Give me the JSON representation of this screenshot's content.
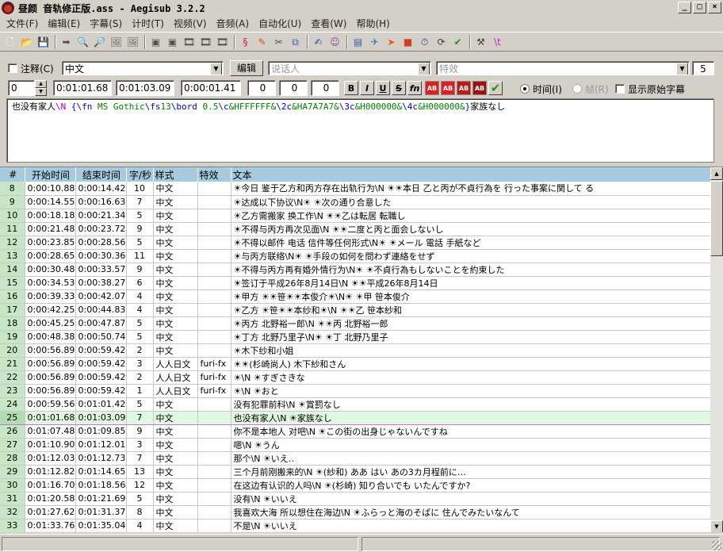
{
  "window": {
    "title": "昼颜 音轨修正版.ass - Aegisub 3.2.2",
    "controls": [
      "_",
      "□",
      "×"
    ]
  },
  "menu": [
    "文件(F)",
    "编辑(E)",
    "字幕(S)",
    "计时(T)",
    "视频(V)",
    "音频(A)",
    "自动化(U)",
    "查看(W)",
    "帮助(H)"
  ],
  "toolbar": [
    {
      "icon": "new-file-icon",
      "glyph": "🗋",
      "color": "#ffffff"
    },
    {
      "icon": "open-folder-icon",
      "glyph": "📂",
      "color": "#d8a838"
    },
    {
      "icon": "save-icon",
      "glyph": "💾",
      "color": "#303060"
    },
    {
      "sep": true
    },
    {
      "icon": "jump-to-icon",
      "glyph": "➡",
      "color": "#505050"
    },
    {
      "icon": "zoom-in-icon",
      "glyph": "🔍",
      "color": "#404040"
    },
    {
      "icon": "zoom-out-icon",
      "glyph": "🔎",
      "color": "#404040"
    },
    {
      "icon": "snapshot-icon",
      "glyph": "🖼",
      "color": "#606060"
    },
    {
      "icon": "snapshot-copy-icon",
      "glyph": "🖼",
      "color": "#606060"
    },
    {
      "sep": true
    },
    {
      "icon": "video-tool-icon",
      "glyph": "▣",
      "color": "#505050"
    },
    {
      "icon": "video-tool-icon",
      "glyph": "▣",
      "color": "#505050"
    },
    {
      "icon": "film-icon",
      "glyph": "🎞",
      "color": "#303030"
    },
    {
      "icon": "film-icon",
      "glyph": "🎞",
      "color": "#303030"
    },
    {
      "icon": "film-icon",
      "glyph": "🎞",
      "color": "#303030"
    },
    {
      "sep": true
    },
    {
      "icon": "styles-icon",
      "glyph": "§",
      "color": "#c02040"
    },
    {
      "icon": "pen-icon",
      "glyph": "✎",
      "color": "#d05020"
    },
    {
      "icon": "attachment-icon",
      "glyph": "✂",
      "color": "#505050"
    },
    {
      "icon": "copy-icon",
      "glyph": "⧉",
      "color": "#3060c0"
    },
    {
      "sep": true
    },
    {
      "icon": "translation-icon",
      "glyph": "✍",
      "color": "#2050b0"
    },
    {
      "icon": "karaoke-icon",
      "glyph": "☺",
      "color": "#9040a0"
    },
    {
      "sep": true
    },
    {
      "icon": "timing-icon",
      "glyph": "▤",
      "color": "#3060b0"
    },
    {
      "icon": "shift-times-icon",
      "glyph": "✈",
      "color": "#2080c0"
    },
    {
      "icon": "arrow-icon",
      "glyph": "➤",
      "color": "#e06010"
    },
    {
      "icon": "stop-icon",
      "glyph": "■",
      "color": "#d04020"
    },
    {
      "icon": "clock-icon",
      "glyph": "⏱",
      "color": "#204080"
    },
    {
      "icon": "resample-icon",
      "glyph": "⟳",
      "color": "#404040"
    },
    {
      "icon": "spellcheck-icon",
      "glyph": "✔",
      "color": "#209020"
    },
    {
      "sep": true
    },
    {
      "icon": "hammer-icon",
      "glyph": "⚒",
      "color": "#404040"
    },
    {
      "icon": "tag-icon",
      "glyph": "\\t",
      "color": "#c020c0"
    }
  ],
  "edit": {
    "comment_label": "注释(C)",
    "style": "中文",
    "edit_button": "编辑",
    "actor_placeholder": "说话人",
    "effect_placeholder": "特效",
    "chars_count": "5",
    "layer": "0",
    "start_time": "0:01:01.68",
    "end_time": "0:01:03.09",
    "duration": "0:00:01.41",
    "margin_l": "0",
    "margin_r": "0",
    "margin_v": "0",
    "bold": "B",
    "italic": "I",
    "underline": "U",
    "strike": "S",
    "font_btn": "fn",
    "color_btns": [
      {
        "label": "AB",
        "color": "#e02020"
      },
      {
        "label": "AB",
        "color": "#e02020"
      },
      {
        "label": "AB",
        "color": "#c01818"
      },
      {
        "label": "AB",
        "color": "#a01010"
      }
    ],
    "commit_icon": "✔",
    "time_mode": "时间(I)",
    "frame_mode": "帧(R)",
    "show_original": "显示原始字幕",
    "text_segments": [
      {
        "t": "也没有家人",
        "c": "t-plain"
      },
      {
        "t": "\\N",
        "c": "t-mark"
      },
      {
        "t": " ",
        "c": "t-plain"
      },
      {
        "t": "{",
        "c": "t-brace"
      },
      {
        "t": "\\fn",
        "c": "t-tag"
      },
      {
        "t": " MS Gothic",
        "c": "t-param"
      },
      {
        "t": "\\fs",
        "c": "t-tag"
      },
      {
        "t": "13",
        "c": "t-param"
      },
      {
        "t": "\\bord",
        "c": "t-tag"
      },
      {
        "t": " 0.5",
        "c": "t-param"
      },
      {
        "t": "\\c",
        "c": "t-tag"
      },
      {
        "t": "&HFFFFFF&",
        "c": "t-param"
      },
      {
        "t": "\\2c",
        "c": "t-tag"
      },
      {
        "t": "&HA7A7A7&",
        "c": "t-param"
      },
      {
        "t": "\\3c",
        "c": "t-tag"
      },
      {
        "t": "&H000000&",
        "c": "t-param"
      },
      {
        "t": "\\4c",
        "c": "t-tag"
      },
      {
        "t": "&H000000&",
        "c": "t-param"
      },
      {
        "t": "}",
        "c": "t-brace"
      },
      {
        "t": "家族なし",
        "c": "t-plain"
      }
    ]
  },
  "grid": {
    "columns": [
      "#",
      "开始时间",
      "结束时间",
      "字/秒",
      "样式",
      "特效",
      "文本"
    ],
    "selected_row": "25",
    "rows": [
      {
        "n": "8",
        "start": "0:00:10.88",
        "end": "0:00:14.42",
        "cps": "10",
        "style": "中文",
        "effect": "",
        "text": "☀今日 鉴于乙方和丙方存在出轨行为\\N ☀☀本日 乙と丙が不貞行為を 行った事案に関して る"
      },
      {
        "n": "9",
        "start": "0:00:14.55",
        "end": "0:00:16.63",
        "cps": "7",
        "style": "中文",
        "effect": "",
        "text": "☀达成以下协议\\N☀ ☀次の通り合意した"
      },
      {
        "n": "10",
        "start": "0:00:18.18",
        "end": "0:00:21.34",
        "cps": "5",
        "style": "中文",
        "effect": "",
        "text": "☀乙方需搬家 换工作\\N ☀☀乙は転居 転職し"
      },
      {
        "n": "11",
        "start": "0:00:21.48",
        "end": "0:00:23.72",
        "cps": "9",
        "style": "中文",
        "effect": "",
        "text": "☀不得与丙方再次见面\\N ☀☀二度と丙と面会しないし"
      },
      {
        "n": "12",
        "start": "0:00:23.85",
        "end": "0:00:28.56",
        "cps": "5",
        "style": "中文",
        "effect": "",
        "text": "☀不得以邮件 电话 信件等任何形式\\N☀ ☀メール 電話 手紙など"
      },
      {
        "n": "13",
        "start": "0:00:28.65",
        "end": "0:00:30.36",
        "cps": "11",
        "style": "中文",
        "effect": "",
        "text": "☀与丙方联络\\N☀ ☀手段の如何を問わず連絡をせず"
      },
      {
        "n": "14",
        "start": "0:00:30.48",
        "end": "0:00:33.57",
        "cps": "9",
        "style": "中文",
        "effect": "",
        "text": "☀不得与丙方再有婚外情行为\\N☀ ☀不貞行為もしないことを約束した"
      },
      {
        "n": "15",
        "start": "0:00:34.53",
        "end": "0:00:38.27",
        "cps": "6",
        "style": "中文",
        "effect": "",
        "text": "☀签订于平成26年8月14日\\N ☀☀平成26年8月14日"
      },
      {
        "n": "16",
        "start": "0:00:39.33",
        "end": "0:00:42.07",
        "cps": "4",
        "style": "中文",
        "effect": "",
        "text": "☀甲方 ☀☀笹☀☀本俊介☀\\N☀ ☀甲 笹本俊介"
      },
      {
        "n": "17",
        "start": "0:00:42.25",
        "end": "0:00:44.83",
        "cps": "4",
        "style": "中文",
        "effect": "",
        "text": "☀乙方 ☀笹☀☀本纱和☀\\N ☀☀乙 笹本紗和"
      },
      {
        "n": "18",
        "start": "0:00:45.25",
        "end": "0:00:47.87",
        "cps": "5",
        "style": "中文",
        "effect": "",
        "text": "☀丙方 北野裕一郎\\N ☀☀丙 北野裕一郎"
      },
      {
        "n": "19",
        "start": "0:00:48.38",
        "end": "0:00:50.74",
        "cps": "5",
        "style": "中文",
        "effect": "",
        "text": "☀丁方 北野乃里子\\N☀ ☀丁 北野乃里子"
      },
      {
        "n": "20",
        "start": "0:00:56.89",
        "end": "0:00:59.42",
        "cps": "2",
        "style": "中文",
        "effect": "",
        "text": "☀木下纱和小姐"
      },
      {
        "n": "21",
        "start": "0:00:56.89",
        "end": "0:00:59.42",
        "cps": "3",
        "style": "人人日文",
        "effect": "furi-fx",
        "text": "☀☀(杉崎尚人) 木下紗和さん"
      },
      {
        "n": "22",
        "start": "0:00:56.89",
        "end": "0:00:59.42",
        "cps": "2",
        "style": "人人日文",
        "effect": "furi-fx",
        "text": "☀\\N ☀すぎさきな"
      },
      {
        "n": "23",
        "start": "0:00:56.89",
        "end": "0:00:59.42",
        "cps": "1",
        "style": "人人日文",
        "effect": "furi-fx",
        "text": "☀\\N ☀おと"
      },
      {
        "n": "24",
        "start": "0:00:59.56",
        "end": "0:01:01.42",
        "cps": "5",
        "style": "中文",
        "effect": "",
        "text": "没有犯罪前科\\N ☀賞罰なし"
      },
      {
        "n": "25",
        "start": "0:01:01.68",
        "end": "0:01:03.09",
        "cps": "7",
        "style": "中文",
        "effect": "",
        "text": "也没有家人\\N ☀家族なし"
      },
      {
        "n": "26",
        "start": "0:01:07.48",
        "end": "0:01:09.85",
        "cps": "9",
        "style": "中文",
        "effect": "",
        "text": "你不是本地人 对吧\\N ☀この街の出身じゃないんですね"
      },
      {
        "n": "27",
        "start": "0:01:10.90",
        "end": "0:01:12.01",
        "cps": "3",
        "style": "中文",
        "effect": "",
        "text": "嗯\\N ☀うん"
      },
      {
        "n": "28",
        "start": "0:01:12.03",
        "end": "0:01:12.73",
        "cps": "7",
        "style": "中文",
        "effect": "",
        "text": "那个\\N ☀いえ‥"
      },
      {
        "n": "29",
        "start": "0:01:12.82",
        "end": "0:01:14.65",
        "cps": "13",
        "style": "中文",
        "effect": "",
        "text": "三个月前刚搬来的\\N ☀(紗和) ああ はい あの3カ月程前に…"
      },
      {
        "n": "30",
        "start": "0:01:16.70",
        "end": "0:01:18.56",
        "cps": "12",
        "style": "中文",
        "effect": "",
        "text": "在这边有认识的人吗\\N ☀(杉崎) 知り合いでも いたんですか?"
      },
      {
        "n": "31",
        "start": "0:01:20.58",
        "end": "0:01:21.69",
        "cps": "5",
        "style": "中文",
        "effect": "",
        "text": "没有\\N ☀いいえ"
      },
      {
        "n": "32",
        "start": "0:01:27.62",
        "end": "0:01:31.37",
        "cps": "8",
        "style": "中文",
        "effect": "",
        "text": "我喜欢大海 所以想住在海边\\N ☀ふらっと海のそばに 住んでみたいなんて"
      },
      {
        "n": "33",
        "start": "0:01:33.76",
        "end": "0:01:35.04",
        "cps": "4",
        "style": "中文",
        "effect": "",
        "text": "不是\\N ☀いいえ"
      }
    ]
  }
}
